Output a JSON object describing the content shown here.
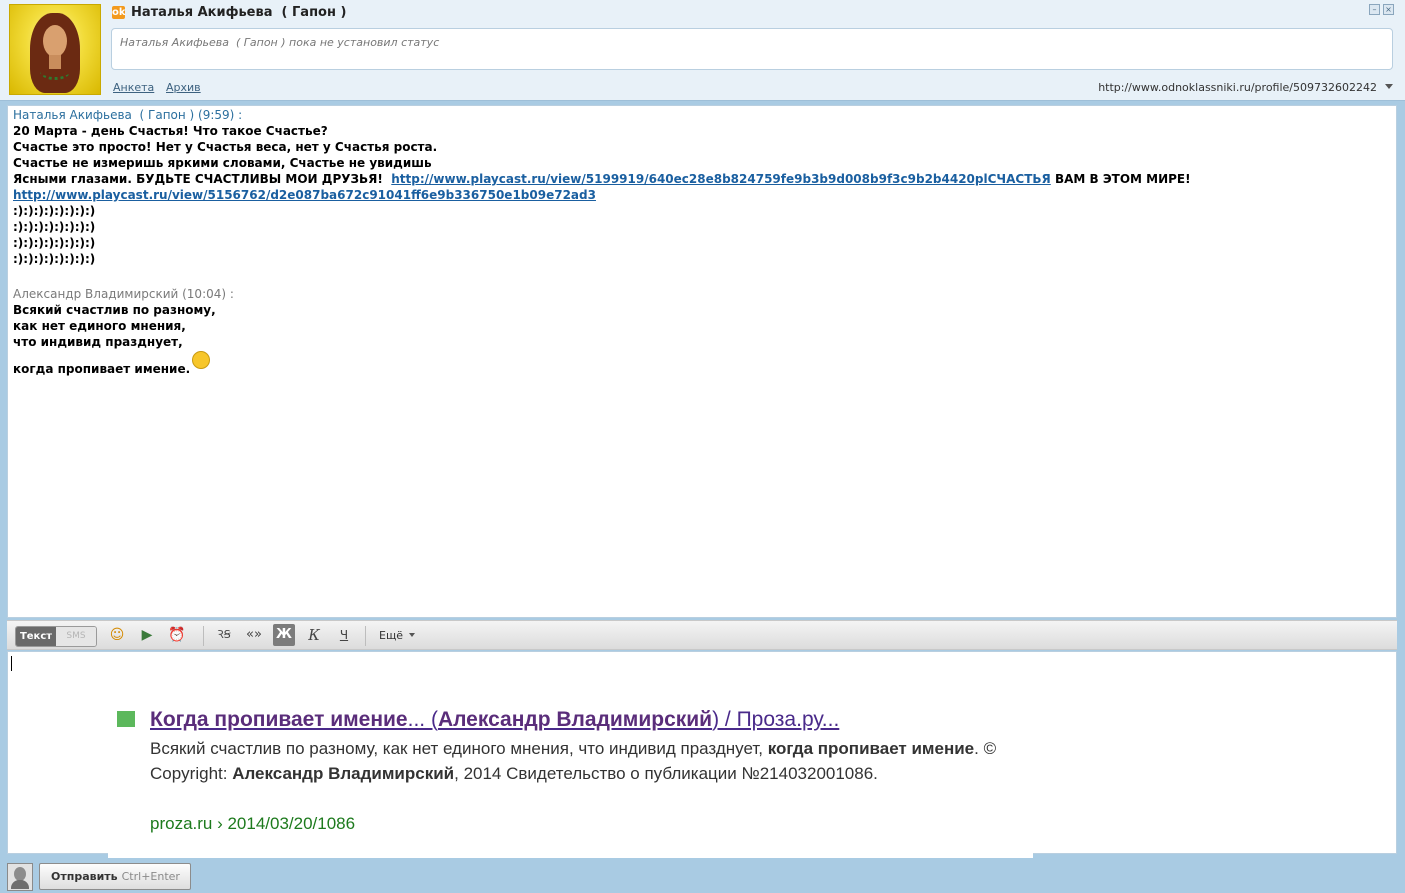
{
  "header": {
    "contact_name": "Наталья Акифьева  ( Гапон )",
    "status_text": "Наталья Акифьева  ( Гапон ) пока не установил статус",
    "links": {
      "profile": "Анкета",
      "archive": "Архив"
    },
    "profile_url": "http://www.odnoklassniki.ru/profile/509732602242",
    "ok_icon_glyph": "ok"
  },
  "messages": [
    {
      "author_time": "Наталья Акифьева  ( Гапон ) (9:59) :",
      "lines": [
        "20 Марта - день Счастья! Что такое Счастье?",
        "Счастье это просто! Нет у Счастья веса, нет у Счастья роста.",
        "Счастье не измеришь яркими словами, Счастье не увидишь",
        "Ясными глазами. БУДЬТЕ СЧАСТЛИВЫ МОИ ДРУЗЬЯ!  "
      ],
      "link1": "http://www.playcast.ru/view/5199919/640ec28e8b824759fe9b3b9d008b9f3c9b2b4420plСЧАСТЬЯ",
      "link1_after": " ВАМ В ЭТОМ МИРЕ!",
      "link2": "http://www.playcast.ru/view/5156762/d2e087ba672c91041ff6e9b336750e1b09e72ad3",
      "smileys": [
        ":):):):):):):):)",
        ":):):):):):):):)",
        ":):):):):):):):)",
        ":):):):):):):):)"
      ]
    },
    {
      "author_time": "Александр Владимирский (10:04) :",
      "lines": [
        "Всякий счастлив по разному,",
        "как нет единого мнения,",
        "что индивид празднует,",
        "когда пропивает имение."
      ]
    }
  ],
  "toolbar": {
    "mode_text": "Текст",
    "mode_sms": "SMS",
    "smile_icon": "☺",
    "video_icon": "▶",
    "alarm_icon": "⏰",
    "translit_icon": "ꝚꞨ",
    "quote_icon": "«»",
    "bold_icon": "Ж",
    "italic_icon": "К",
    "underline_icon": "Ч",
    "more_label": "Ещё"
  },
  "search_result": {
    "title_b1": "Когда пропивает имение",
    "title_t1": "... (",
    "title_b2": "Александр Владимирский",
    "title_t2": ") / Проза.ру...",
    "snippet_1": "Всякий счастлив по разному, как нет единого мнения, что индивид празднует, ",
    "snippet_b1": "когда пропивает имение",
    "snippet_2": ". © Copyright: ",
    "snippet_b2": "Александр Владимирский",
    "snippet_3": ", 2014 Свидетельство о публикации №214032001086.",
    "url": "proza.ru › 2014/03/20/1086"
  },
  "bottom": {
    "send_label": "Отправить",
    "send_hint": "Ctrl+Enter"
  },
  "colors": {
    "background": "#a9cbe3",
    "name_blue": "#2b6f9e",
    "link_blue": "#1a5fa0",
    "title_purple": "#4a2a8a",
    "url_green": "#1d7a1d",
    "square_green": "#5cb85c"
  }
}
